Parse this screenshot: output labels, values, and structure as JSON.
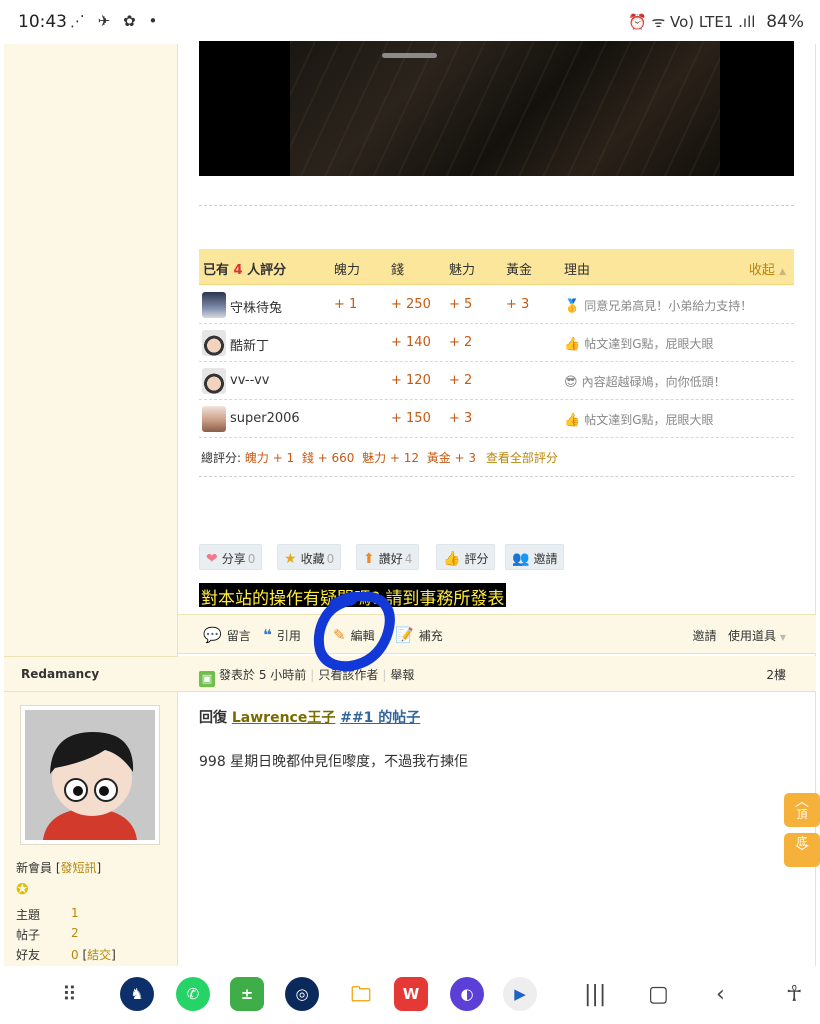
{
  "status": {
    "time": "10:43",
    "left_icons": "⋰ ✈ ✿ •",
    "right_icons": "⏰ ᯤ Vo) LTE1 .ıll",
    "battery": "84%"
  },
  "rating": {
    "summary_prefix": "已有",
    "summary_count": "4",
    "summary_suffix": "人評分",
    "columns": [
      "魄力",
      "錢",
      "魅力",
      "黃金",
      "理由"
    ],
    "collapse": "收起",
    "rows": [
      {
        "name": "守株待兔",
        "power": "+ 1",
        "money": "+ 250",
        "charm": "+ 5",
        "gold": "+ 3",
        "reason_icon": "🥇",
        "reason": "同意兄弟高見！小弟給力支持！"
      },
      {
        "name": "酷新丁",
        "power": "",
        "money": "+ 140",
        "charm": "+ 2",
        "gold": "",
        "reason_icon": "👍",
        "reason": "帖文達到G點，屁眼大眼"
      },
      {
        "name": "vv--vv",
        "power": "",
        "money": "+ 120",
        "charm": "+ 2",
        "gold": "",
        "reason_icon": "😎",
        "reason": "內容超越碌鳩，向你低頭！"
      },
      {
        "name": "super2006",
        "power": "",
        "money": "+ 150",
        "charm": "+ 3",
        "gold": "",
        "reason_icon": "👍",
        "reason": "帖文達到G點，屁眼大眼"
      }
    ],
    "total_label": "總評分:",
    "total_power": "魄力 + 1",
    "total_money": "錢 + 660",
    "total_charm": "魅力 + 12",
    "total_gold": "黃金 + 3",
    "view_all": "查看全部評分"
  },
  "actions": {
    "share": "分享",
    "share_count": "0",
    "favorite": "收藏",
    "favorite_count": "0",
    "like": "讚好",
    "like_count": "4",
    "rate": "評分",
    "invite": "邀請"
  },
  "banner": "對本站的操作有疑問嗎? 請到事務所發表",
  "post_tools": {
    "comment": "留言",
    "quote": "引用",
    "edit": "編輯",
    "supplement": "補充",
    "invite": "邀請",
    "use_tool": "使用道具"
  },
  "next_post": {
    "author": "Redamancy",
    "posted": "發表於 5 小時前",
    "only_author": "只看該作者",
    "report": "舉報",
    "floor": "2樓",
    "reply_prefix": "回復",
    "reply_user": "Lawrence王子",
    "reply_ref": "##1 的帖子",
    "body": "998 星期日晚都仲見佢嚟度，不過我冇揀佢"
  },
  "author_info": {
    "rank": "新會員",
    "pm_link": "發短訊",
    "topics_label": "主題",
    "topics": "1",
    "posts_label": "帖子",
    "posts": "2",
    "friends_label": "好友",
    "friends": "0",
    "add_friend": "結交"
  },
  "float": {
    "top_char": "頂",
    "bottom_char": "底"
  },
  "colors": {
    "panel_bg": "#fcf8e5",
    "rating_header": "#fbe69c",
    "accent_orange": "#c65a13",
    "link_gold": "#b8860b",
    "float_btn": "#f5b13a",
    "scribble": "#1238d8"
  }
}
